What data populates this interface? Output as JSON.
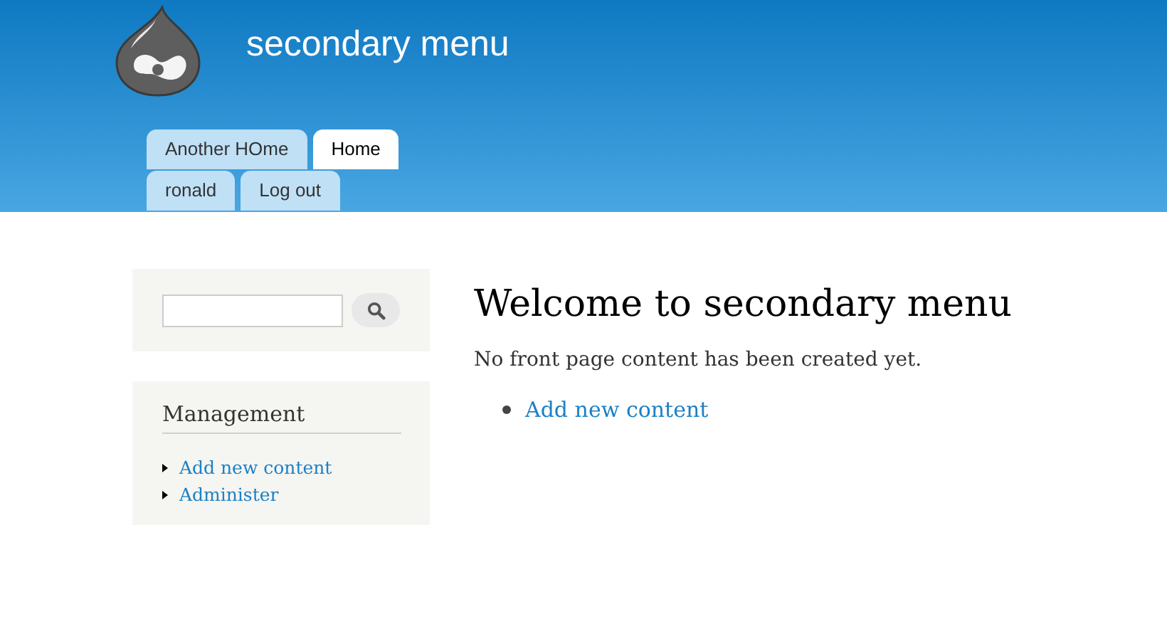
{
  "site": {
    "title": "secondary menu"
  },
  "main_menu": [
    {
      "label": "Another HOme",
      "selected": false
    },
    {
      "label": "Home",
      "selected": true
    }
  ],
  "secondary_menu": [
    {
      "label": "ronald",
      "selected": false
    },
    {
      "label": "Log out",
      "selected": false
    }
  ],
  "sidebar": {
    "management": {
      "title": "Management",
      "items": [
        {
          "label": "Add new content"
        },
        {
          "label": "Administer"
        }
      ]
    }
  },
  "content": {
    "title": "Welcome to secondary menu",
    "message": "No front page content has been created yet.",
    "links": [
      {
        "label": "Add new content"
      }
    ]
  }
}
